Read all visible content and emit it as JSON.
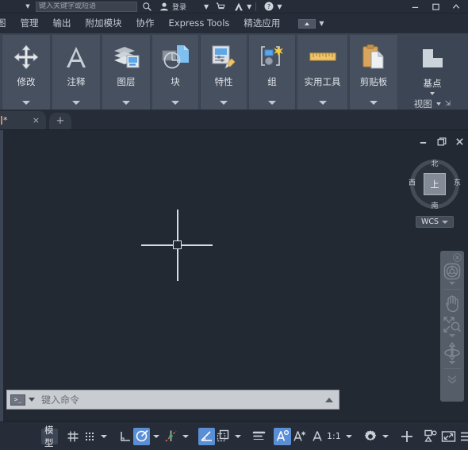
{
  "topbar": {
    "search_placeholder": "键入关键字或短语",
    "signin_label": "登录",
    "icons": {
      "qa_caret": "chevron-down-icon",
      "search": "search-icon",
      "account": "account-icon",
      "cart": "cart-icon",
      "autodesk": "autodesk-a-icon",
      "help": "help-icon"
    },
    "window": {
      "minimize": "minimize-icon",
      "maximize": "maximize-icon",
      "close": "close-icon"
    }
  },
  "menu": {
    "items": [
      {
        "label": "图"
      },
      {
        "label": "管理"
      },
      {
        "label": "输出"
      },
      {
        "label": "附加模块"
      },
      {
        "label": "协作"
      },
      {
        "label": "Express Tools"
      },
      {
        "label": "精选应用"
      }
    ],
    "overflow_label": ""
  },
  "ribbon": {
    "panels": [
      {
        "label": "修改",
        "icon": "move-arrows-icon",
        "has_dropdown": true
      },
      {
        "label": "注释",
        "icon": "text-a-icon",
        "has_dropdown": true
      },
      {
        "label": "图层",
        "icon": "layers-icon",
        "has_dropdown": true
      },
      {
        "label": "块",
        "icon": "block-icon",
        "has_dropdown": true
      },
      {
        "label": "特性",
        "icon": "properties-brush-icon",
        "has_dropdown": true
      },
      {
        "label": "组",
        "icon": "group-icon",
        "has_dropdown": true
      },
      {
        "label": "实用工具",
        "icon": "ruler-icon",
        "has_dropdown": true
      },
      {
        "label": "剪贴板",
        "icon": "clipboard-icon",
        "has_dropdown": true
      }
    ],
    "view_panel": {
      "button_label": "基点",
      "icon": "basepoint-icon",
      "group_label": "视图",
      "launcher": "⇲"
    }
  },
  "tabs": {
    "document": {
      "label": "*",
      "close": "×"
    },
    "new_tab": "+"
  },
  "drawing": {
    "window_controls": {
      "minimize": "minimize-icon",
      "restore": "restore-icon",
      "close": "close-icon"
    },
    "viewcube": {
      "top": "上",
      "north": "北",
      "south": "南",
      "west": "西",
      "east": "东"
    },
    "ucs": {
      "label": "WCS"
    },
    "navbar": {
      "items": [
        {
          "name": "steering-wheel-icon"
        },
        {
          "name": "pan-hand-icon"
        },
        {
          "name": "zoom-extents-icon"
        },
        {
          "name": "orbit-icon"
        },
        {
          "name": "more-chevron-icon"
        }
      ]
    }
  },
  "command": {
    "placeholder": "键入命令",
    "icon": "command-prompt-icon",
    "expand": "chevron-up-icon"
  },
  "statusbar": {
    "model_label": "模型",
    "scale_label": "1:1",
    "buttons": [
      {
        "name": "grid-display-toggle",
        "icon": "grid-icon",
        "active": false
      },
      {
        "name": "snap-mode-toggle",
        "icon": "snap-dots-icon",
        "active": false
      },
      {
        "name": "ortho-mode-toggle",
        "icon": "ortho-icon",
        "active": false
      },
      {
        "name": "polar-tracking-toggle",
        "icon": "polar-icon",
        "active": true
      },
      {
        "name": "object-snap-tracking-toggle",
        "icon": "osnap-track-icon",
        "active": false
      },
      {
        "name": "object-snap-toggle",
        "icon": "angle-icon",
        "active": false
      },
      {
        "name": "isometric-drafting",
        "icon": "iso-rect-icon",
        "active": false
      },
      {
        "name": "lineweight-toggle",
        "icon": "lineweight-icon",
        "active": false
      },
      {
        "name": "transparency-toggle",
        "icon": "annotation-visibility-icon",
        "active": true
      },
      {
        "name": "selection-cycling",
        "icon": "annotation-autoscale-icon",
        "active": false
      },
      {
        "name": "annotation-monitor",
        "icon": "annotation-scale-icon",
        "active": false
      },
      {
        "name": "customization-gear",
        "icon": "gear-icon",
        "active": false
      },
      {
        "name": "isolate-objects",
        "icon": "plus-icon",
        "active": false
      },
      {
        "name": "workspace-switch",
        "icon": "workspace-icon",
        "active": false
      },
      {
        "name": "clean-screen",
        "icon": "fullscreen-icon",
        "active": false
      },
      {
        "name": "customization-menu",
        "icon": "hamburger-icon",
        "active": false
      }
    ]
  },
  "colors": {
    "canvas": "#232932",
    "ribbon_bg": "#3c4553",
    "panel_bg": "#47505f",
    "chrome": "#262d38",
    "accent": "#5a8fd6",
    "text": "#dfe3e8"
  }
}
